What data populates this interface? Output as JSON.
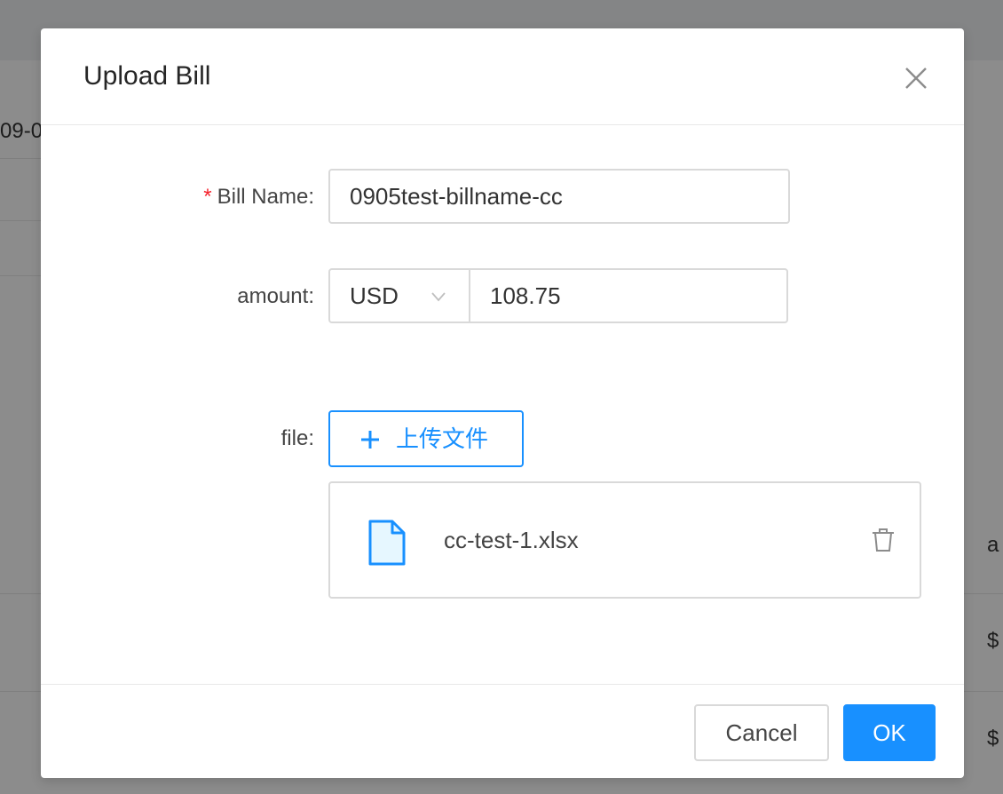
{
  "background": {
    "date_fragment": "09-0",
    "right_cells": [
      "a",
      "$",
      "$"
    ]
  },
  "modal": {
    "title": "Upload Bill",
    "close_icon": "close-icon",
    "fields": {
      "bill_name": {
        "label": "Bill Name",
        "required": true,
        "value": "0905test-billname-cc"
      },
      "amount": {
        "label": "amount",
        "currency": "USD",
        "value": "108.75"
      },
      "file": {
        "label": "file",
        "upload_button": "上传文件",
        "uploaded_file": "cc-test-1.xlsx"
      }
    },
    "footer": {
      "cancel": "Cancel",
      "ok": "OK"
    }
  },
  "colors": {
    "primary": "#1890ff",
    "required": "#f5222d",
    "border": "#d9d9d9"
  }
}
